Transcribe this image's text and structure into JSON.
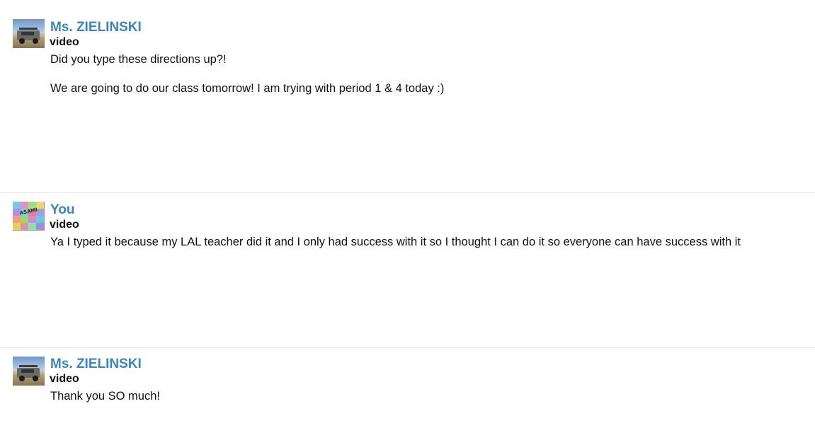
{
  "messages": [
    {
      "sender": "Ms. ZIELINSKI",
      "subject": "video",
      "avatar_icon": "jeep-photo-avatar",
      "paragraphs": [
        "Did you type these directions up?!",
        "We are going to do our class tomorrow! I am trying with period 1 & 4 today :)"
      ]
    },
    {
      "sender": "You",
      "subject": "video",
      "avatar_icon": "collage-avatar",
      "avatar_text": "ASAMI",
      "paragraphs": [
        "Ya I typed it because my LAL teacher did it and I only had success with it so I thought I can do it so everyone can have success with it"
      ]
    },
    {
      "sender": "Ms. ZIELINSKI",
      "subject": "video",
      "avatar_icon": "jeep-photo-avatar",
      "paragraphs": [
        "Thank you SO much!"
      ]
    }
  ],
  "colors": {
    "sender": "#3b84c1",
    "divider": "#e3e3e3",
    "text": "#111111"
  }
}
